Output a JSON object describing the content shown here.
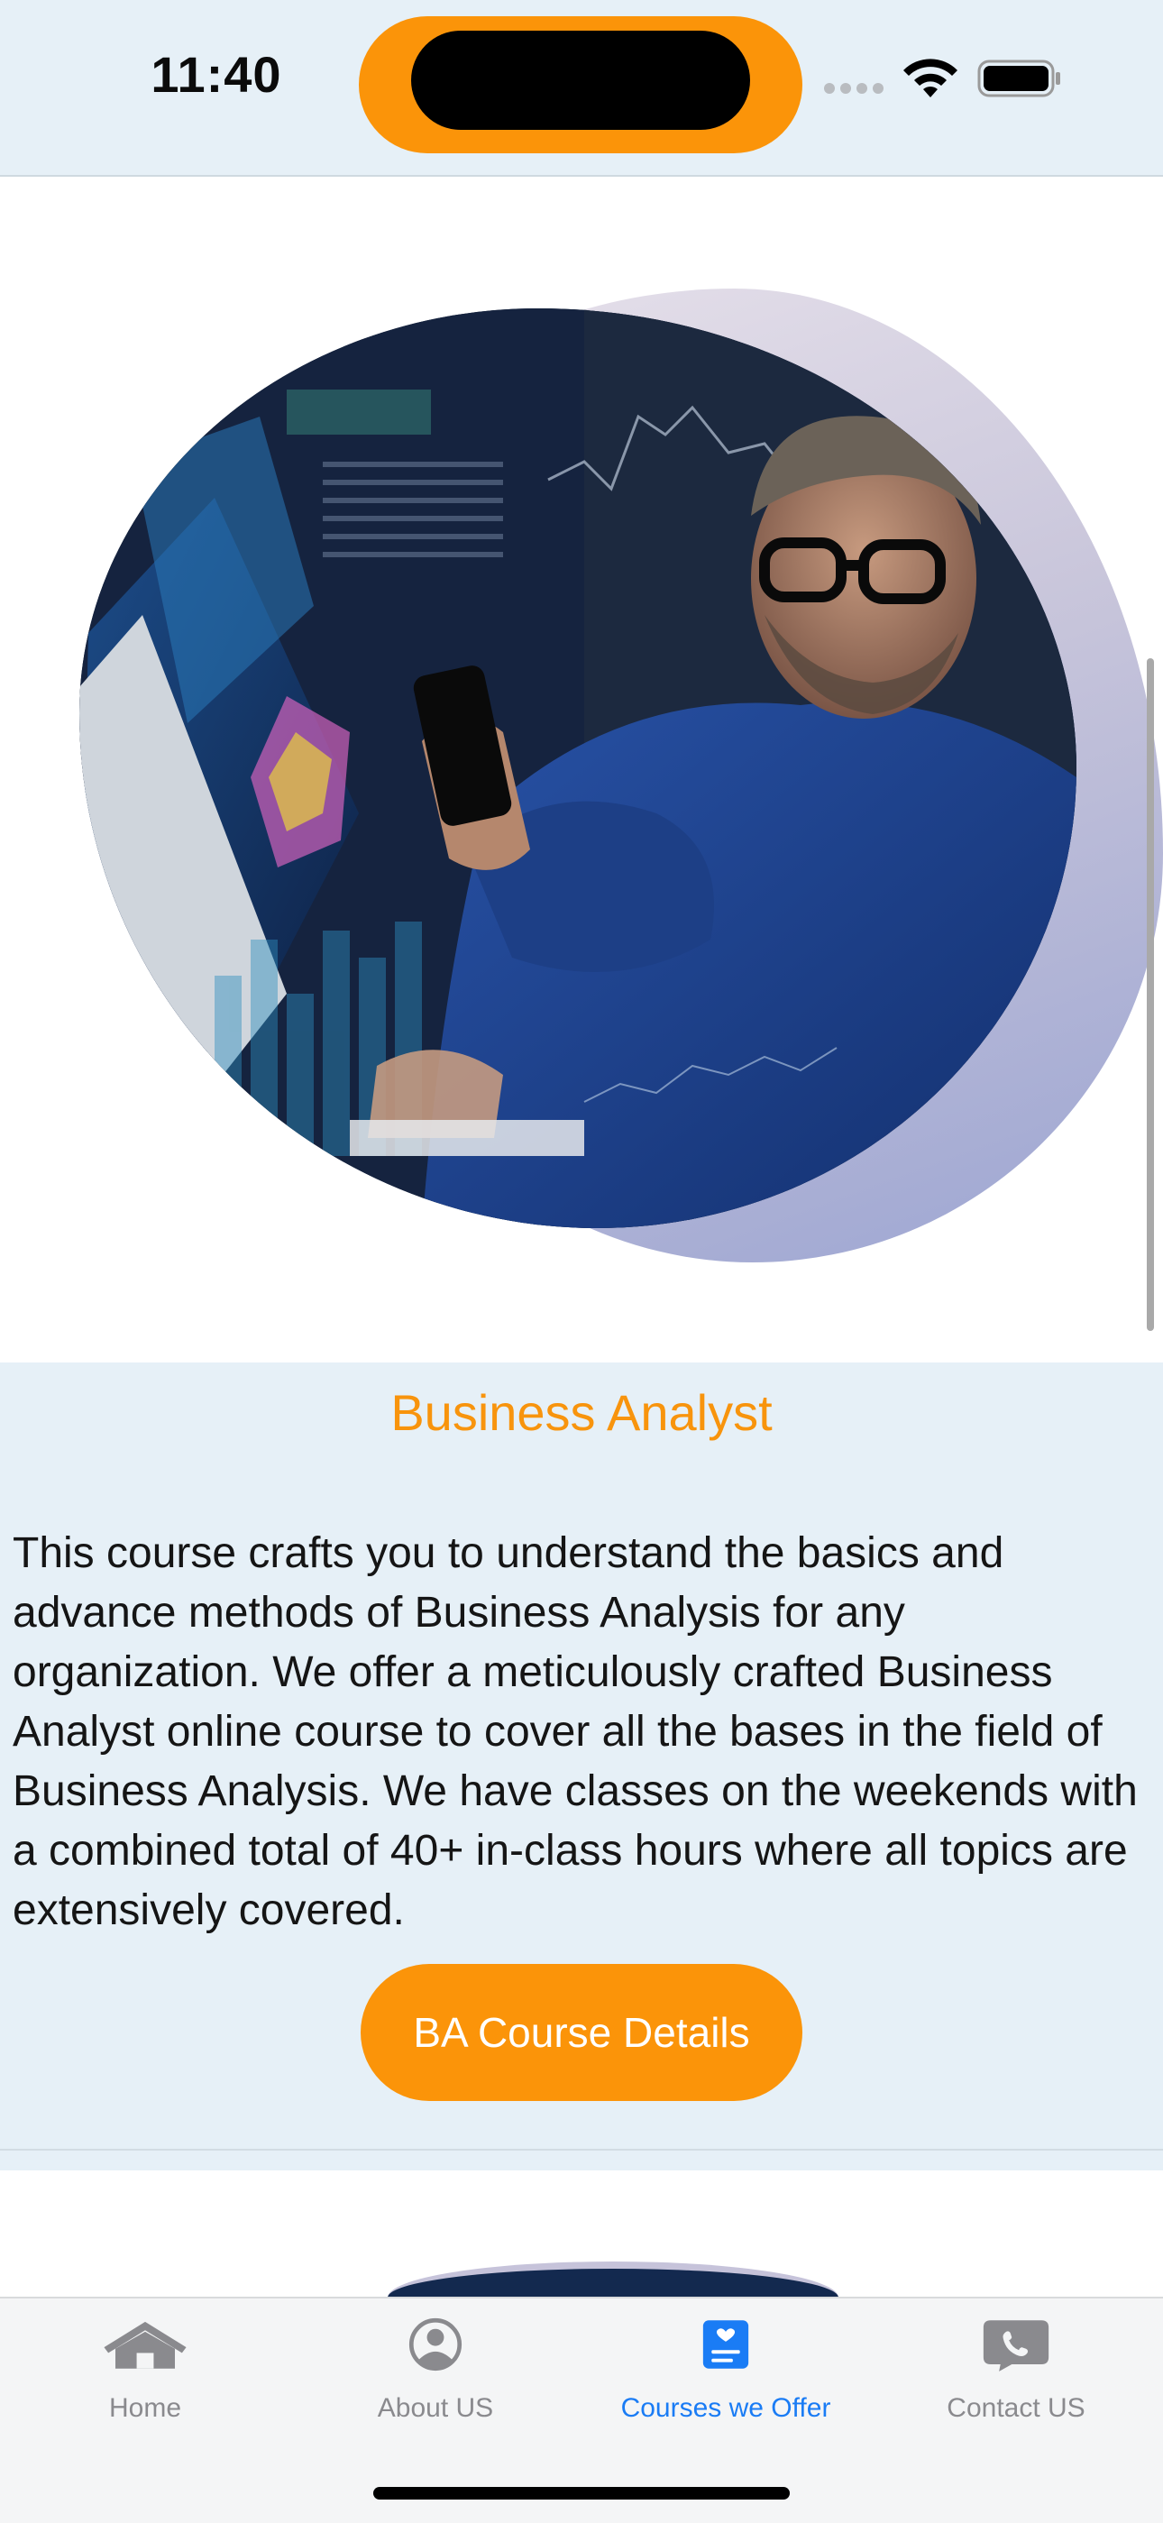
{
  "status_bar": {
    "time": "11:40"
  },
  "course": {
    "title": "Business Analyst",
    "description": "This course crafts you to understand the basics and advance methods of Business Analysis for any organization. We offer a meticulously crafted Business Analyst online course to cover all the bases in the field of Business Analysis. We have classes on the weekends with a combined total of 40+ in-class hours where all topics are extensively covered.",
    "button_label": "BA Course Details"
  },
  "tab_bar": {
    "tabs": [
      {
        "label": "Home",
        "icon": "house-icon",
        "active": false
      },
      {
        "label": "About US",
        "icon": "person-circle-icon",
        "active": false
      },
      {
        "label": "Courses we Offer",
        "icon": "list-heart-icon",
        "active": true
      },
      {
        "label": "Contact US",
        "icon": "phone-bubble-icon",
        "active": false
      }
    ]
  },
  "colors": {
    "accent": "#fb9409",
    "title": "#f8940d",
    "card_background": "#e6f0f7",
    "tab_active": "#1a7cf5",
    "tab_inactive": "#8a8a8e"
  }
}
